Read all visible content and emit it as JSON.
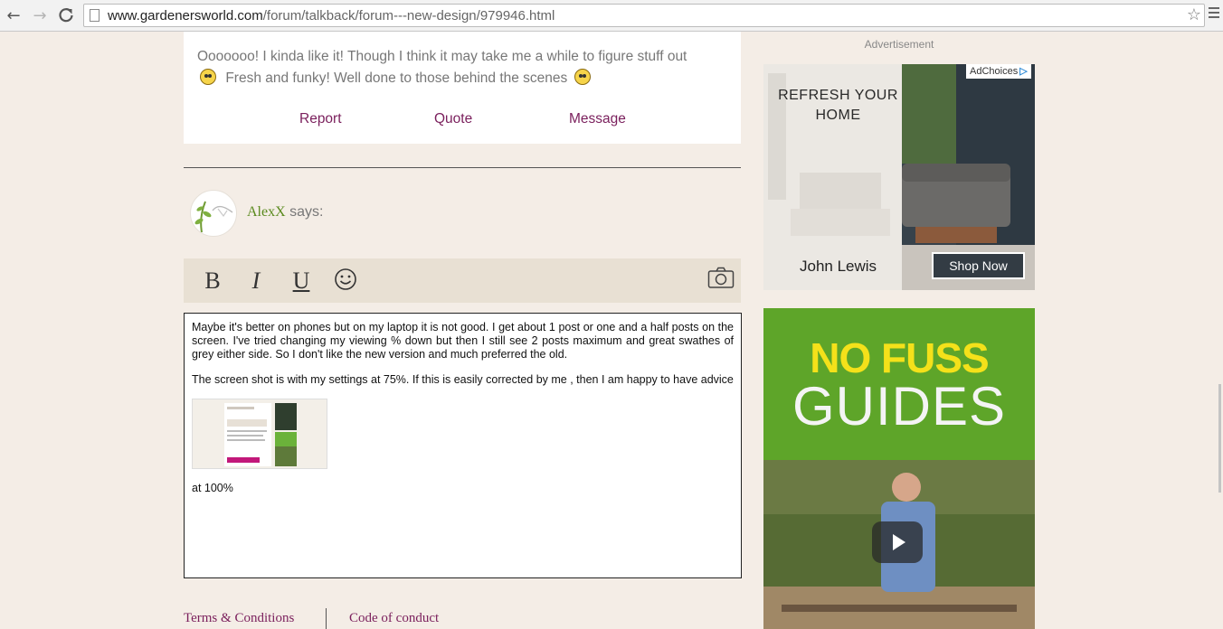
{
  "browser": {
    "url_host": "www.gardenersworld.com",
    "url_path": "/forum/talkback/forum---new-design/979946.html"
  },
  "post": {
    "text_part1": "Ooooooo!  I kinda like it!  Though I think it may take me a while to figure stuff out",
    "text_part2": "Fresh and funky! Well done to those behind the scenes",
    "actions": [
      "Report",
      "Quote",
      "Message"
    ]
  },
  "reply": {
    "author": "AlexX",
    "says": "says:",
    "toolbar": {
      "bold": "B",
      "italic": "I",
      "underline": "U"
    },
    "editor": {
      "paragraph1": "Maybe it's better on phones but on my laptop it is not good. I get about 1 post or one and a half posts on the screen. I've tried changing my viewing % down but then I still see 2 posts maximum and great swathes of grey either side. So I don't like the new version and much preferred the old.",
      "paragraph2": "The screen shot is with my settings at 75%. If this is easily corrected by me , then I am happy to have advice",
      "caption": "at 100%"
    }
  },
  "footer": {
    "terms": "Terms & Conditions",
    "conduct": "Code of conduct"
  },
  "sidebar": {
    "ad_label": "Advertisement",
    "ad1": {
      "adchoices": "AdChoices",
      "headline": "REFRESH YOUR HOME",
      "brand": "John Lewis",
      "cta": "Shop Now"
    },
    "ad2": {
      "line1": "NO FUSS",
      "line2": "GUIDES"
    }
  },
  "colors": {
    "accent": "#7a1f5c",
    "author": "#5a8a1e",
    "background": "#f4ede6",
    "ad_green": "#5ea529",
    "ad_yellow": "#f4e11a"
  }
}
